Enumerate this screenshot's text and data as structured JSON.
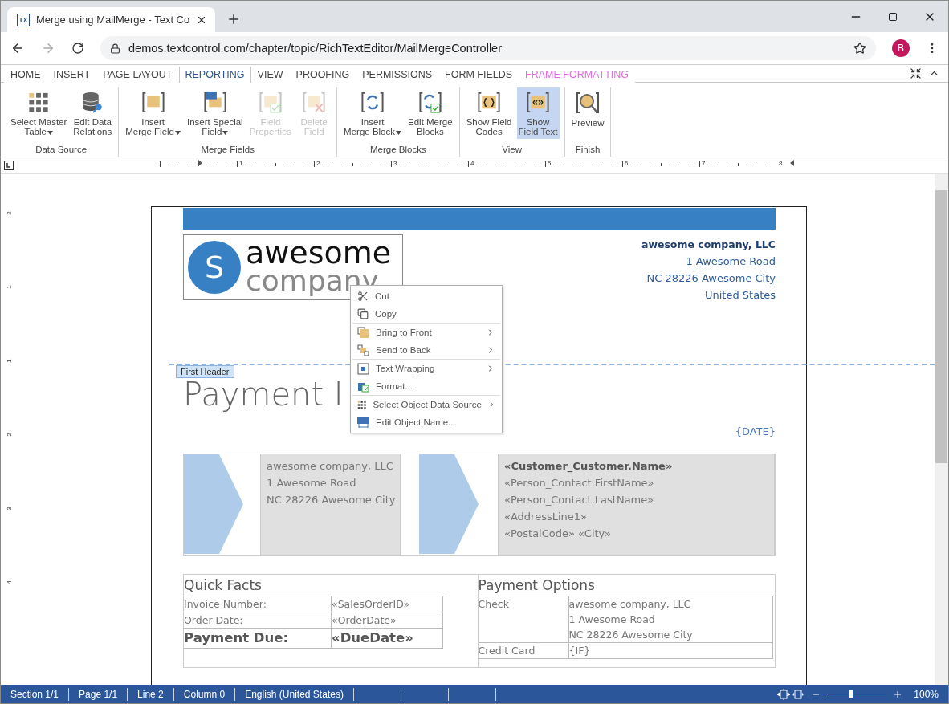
{
  "browser": {
    "tab": {
      "title": "Merge using MailMerge - Text Co",
      "icon_text": "TX"
    },
    "url": "demos.textcontrol.com/chapter/topic/RichTextEditor/MailMergeController",
    "avatar": "B"
  },
  "ribbon": {
    "tabs": [
      {
        "label": "HOME",
        "selected": false,
        "kind": "standard"
      },
      {
        "label": "INSERT",
        "selected": false,
        "kind": "standard"
      },
      {
        "label": "PAGE LAYOUT",
        "selected": false,
        "kind": "standard"
      },
      {
        "label": "REPORTING",
        "selected": true,
        "kind": "standard"
      },
      {
        "label": "VIEW",
        "selected": false,
        "kind": "standard"
      },
      {
        "label": "PROOFING",
        "selected": false,
        "kind": "standard"
      },
      {
        "label": "PERMISSIONS",
        "selected": false,
        "kind": "standard"
      },
      {
        "label": "FORM FIELDS",
        "selected": false,
        "kind": "standard"
      },
      {
        "label": "FRAME FORMATTING",
        "selected": false,
        "kind": "contextual"
      }
    ],
    "groups": [
      {
        "label": "Data Source",
        "buttons": [
          {
            "lines": [
              "Select Master",
              "Table"
            ],
            "dropdown": true,
            "disabled": false,
            "selected": false
          },
          {
            "lines": [
              "Edit Data",
              "Relations"
            ],
            "dropdown": false,
            "disabled": false,
            "selected": false
          }
        ]
      },
      {
        "label": "Merge Fields",
        "buttons": [
          {
            "lines": [
              "Insert",
              "Merge Field"
            ],
            "dropdown": true,
            "disabled": false,
            "selected": false
          },
          {
            "lines": [
              "Insert Special",
              "Field"
            ],
            "dropdown": true,
            "disabled": false,
            "selected": false
          },
          {
            "lines": [
              "Field",
              "Properties"
            ],
            "dropdown": false,
            "disabled": true,
            "selected": false
          },
          {
            "lines": [
              "Delete",
              "Field"
            ],
            "dropdown": false,
            "disabled": true,
            "selected": false
          }
        ]
      },
      {
        "label": "Merge Blocks",
        "buttons": [
          {
            "lines": [
              "Insert",
              "Merge Block"
            ],
            "dropdown": true,
            "disabled": false,
            "selected": false
          },
          {
            "lines": [
              "Edit Merge",
              "Blocks"
            ],
            "dropdown": false,
            "disabled": false,
            "selected": false
          }
        ]
      },
      {
        "label": "View",
        "buttons": [
          {
            "lines": [
              "Show Field",
              "Codes"
            ],
            "dropdown": false,
            "disabled": false,
            "selected": false
          },
          {
            "lines": [
              "Show",
              "Field Text"
            ],
            "dropdown": false,
            "disabled": false,
            "selected": true
          }
        ]
      },
      {
        "label": "Finish",
        "buttons": [
          {
            "lines": [
              "Preview"
            ],
            "dropdown": false,
            "disabled": false,
            "selected": false
          }
        ]
      }
    ]
  },
  "ruler": {
    "labels": [
      "1",
      "2",
      "3",
      "4",
      "5",
      "6",
      "7",
      "8"
    ],
    "vertical_labels": [
      "2",
      "1",
      "1",
      "2",
      "3",
      "4"
    ]
  },
  "document": {
    "logo": {
      "letter": "S",
      "line1": "awesome",
      "line2": "company"
    },
    "sender": [
      {
        "text": "awesome company, LLC",
        "bold": true
      },
      {
        "text": "1 Awesome Road",
        "bold": false
      },
      {
        "text": "NC 28226 Awesome City",
        "bold": false
      },
      {
        "text": "United States",
        "bold": false
      }
    ],
    "section_label": "First Header",
    "title": "Payment I",
    "date_field": "{DATE}",
    "address_from": [
      "awesome company, LLC",
      "1 Awesome Road",
      "NC 28226 Awesome City"
    ],
    "address_to": [
      {
        "text": "«Customer_Customer.Name»",
        "bold": true
      },
      {
        "text": "«Person_Contact.FirstName»",
        "bold": false
      },
      {
        "text": "«Person_Contact.LastName»",
        "bold": false
      },
      {
        "text": "«AddressLine1»",
        "bold": false
      },
      {
        "text": "«PostalCode» «City»",
        "bold": false
      }
    ],
    "quick_facts": {
      "title": "Quick Facts",
      "rows": [
        {
          "label": "Invoice Number:",
          "value": "«SalesOrderID»",
          "emphasis": false
        },
        {
          "label": "Order Date:",
          "value": "«OrderDate»",
          "emphasis": false
        },
        {
          "label": "Payment Due:",
          "value": "«DueDate»",
          "emphasis": true
        }
      ]
    },
    "payment_options": {
      "title": "Payment Options",
      "rows": [
        {
          "label": "Check",
          "lines": [
            "awesome company, LLC",
            "1 Awesome Road",
            "NC 28226 Awesome City"
          ]
        },
        {
          "label": "Credit Card",
          "lines": [
            "{IF}"
          ]
        }
      ]
    }
  },
  "context_menu": [
    {
      "label": "Cut",
      "submenu": false,
      "separator_before": false
    },
    {
      "label": "Copy",
      "submenu": false,
      "separator_before": false
    },
    {
      "label": "Bring to Front",
      "submenu": true,
      "separator_before": true
    },
    {
      "label": "Send to Back",
      "submenu": true,
      "separator_before": false
    },
    {
      "label": "Text Wrapping",
      "submenu": true,
      "separator_before": true
    },
    {
      "label": "Format...",
      "submenu": false,
      "separator_before": false
    },
    {
      "label": "Select Object Data Source",
      "submenu": true,
      "separator_before": true
    },
    {
      "label": "Edit Object Name...",
      "submenu": false,
      "separator_before": false
    }
  ],
  "status_bar": {
    "items": [
      "Section 1/1",
      "Page 1/1",
      "Line 2",
      "Column 0",
      "English (United States)"
    ],
    "zoom": {
      "level": 0.37,
      "reading": "100%"
    }
  }
}
